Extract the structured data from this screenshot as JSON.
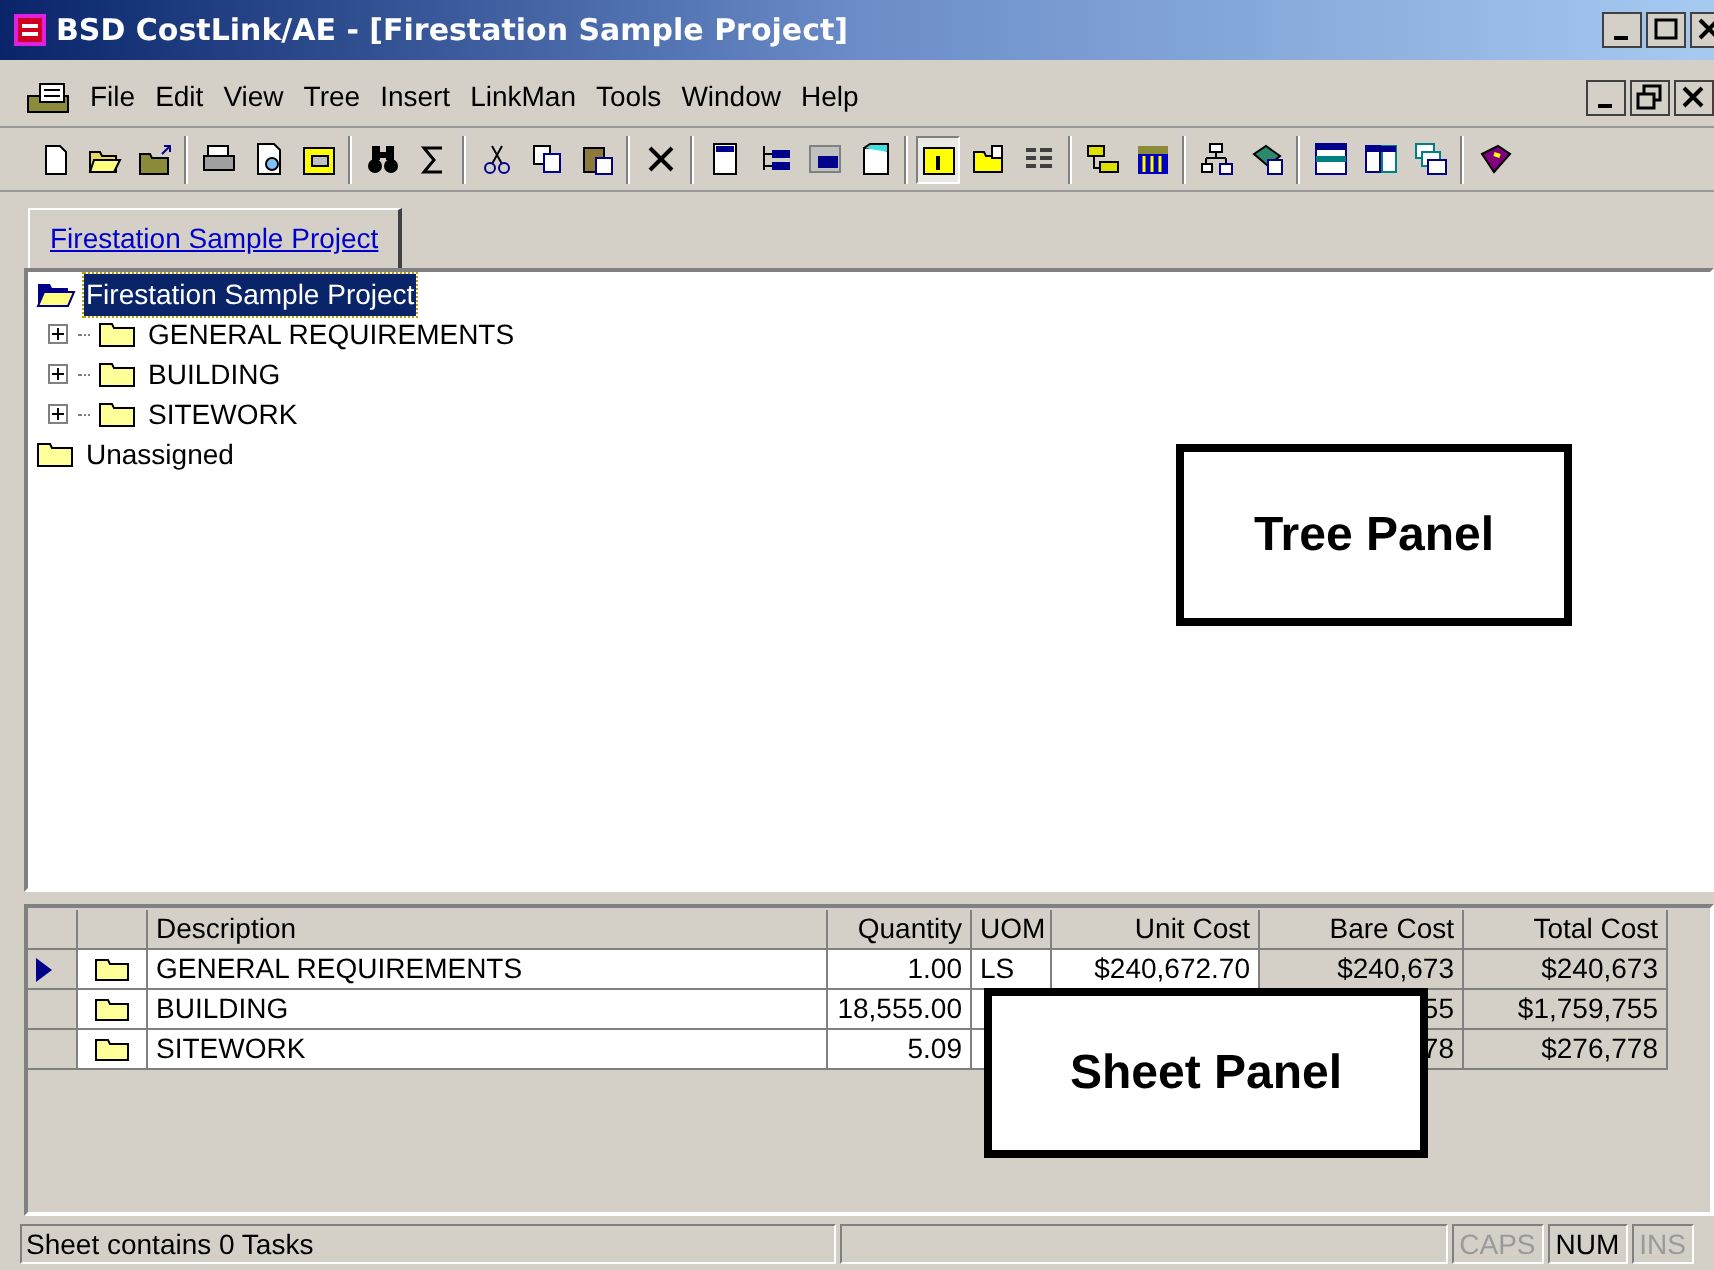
{
  "window": {
    "title": "BSD CostLink/AE - [Firestation Sample Project]"
  },
  "menu": [
    {
      "label": "File"
    },
    {
      "label": "Edit"
    },
    {
      "label": "View"
    },
    {
      "label": "Tree"
    },
    {
      "label": "Insert"
    },
    {
      "label": "LinkMan"
    },
    {
      "label": "Tools"
    },
    {
      "label": "Window"
    },
    {
      "label": "Help"
    }
  ],
  "toolbar": [
    {
      "kind": "new",
      "pressed": false
    },
    {
      "kind": "open",
      "pressed": false
    },
    {
      "kind": "open-up",
      "pressed": false
    },
    {
      "kind": "sep"
    },
    {
      "kind": "print",
      "pressed": false
    },
    {
      "kind": "preview",
      "pressed": false
    },
    {
      "kind": "folder-disk",
      "pressed": false
    },
    {
      "kind": "sep"
    },
    {
      "kind": "binoculars",
      "pressed": false
    },
    {
      "kind": "sigma",
      "pressed": false
    },
    {
      "kind": "sep"
    },
    {
      "kind": "cut",
      "pressed": false
    },
    {
      "kind": "copy",
      "pressed": false
    },
    {
      "kind": "paste",
      "pressed": false
    },
    {
      "kind": "sep"
    },
    {
      "kind": "delete",
      "pressed": false
    },
    {
      "kind": "sep"
    },
    {
      "kind": "doc",
      "pressed": false
    },
    {
      "kind": "tree",
      "pressed": false
    },
    {
      "kind": "grid",
      "pressed": false
    },
    {
      "kind": "page",
      "pressed": false
    },
    {
      "kind": "sep"
    },
    {
      "kind": "folder-one",
      "pressed": true
    },
    {
      "kind": "folder-up",
      "pressed": false
    },
    {
      "kind": "list",
      "pressed": false
    },
    {
      "kind": "sep"
    },
    {
      "kind": "folders",
      "pressed": false
    },
    {
      "kind": "alt",
      "pressed": false
    },
    {
      "kind": "sep"
    },
    {
      "kind": "org",
      "pressed": false
    },
    {
      "kind": "drive",
      "pressed": false
    },
    {
      "kind": "sep"
    },
    {
      "kind": "rows",
      "pressed": false
    },
    {
      "kind": "columns",
      "pressed": false
    },
    {
      "kind": "windows",
      "pressed": false
    },
    {
      "kind": "sep"
    },
    {
      "kind": "book",
      "pressed": false
    }
  ],
  "tabs": [
    {
      "label": "Firestation Sample Project",
      "selected": true
    }
  ],
  "tree": [
    {
      "label": "Firestation Sample Project",
      "selected": true,
      "expanded": true,
      "children": [
        {
          "label": "GENERAL REQUIREMENTS",
          "selected": false,
          "expanded": false
        },
        {
          "label": "BUILDING",
          "selected": false,
          "expanded": false
        },
        {
          "label": "SITEWORK",
          "selected": false,
          "expanded": false
        }
      ]
    },
    {
      "label": "Unassigned",
      "selected": false,
      "expanded": false
    }
  ],
  "callouts": [
    {
      "label": "Tree Panel"
    },
    {
      "label": "Sheet Panel"
    }
  ],
  "sheet": {
    "columns": [
      "Description",
      "Quantity",
      "UOM",
      "Unit Cost",
      "Bare Cost",
      "Total Cost"
    ],
    "rows": [
      {
        "selected": true,
        "description": "GENERAL REQUIREMENTS",
        "quantity": "1.00",
        "uom": "LS",
        "unit_cost": "$240,672.70",
        "bare_cost": "$240,673",
        "total_cost": "$240,673"
      },
      {
        "selected": false,
        "description": "BUILDING",
        "quantity": "18,555.00",
        "bare_cost": "55",
        "total_cost": "$1,759,755"
      },
      {
        "selected": false,
        "description": "SITEWORK",
        "quantity": "5.09",
        "bare_cost": "78",
        "total_cost": "$276,778"
      }
    ]
  },
  "status_bar": {
    "message": "Sheet contains 0 Tasks",
    "indicators": [
      {
        "label": "CAPS",
        "on": false
      },
      {
        "label": "NUM",
        "on": true
      },
      {
        "label": "INS",
        "on": false
      }
    ]
  }
}
